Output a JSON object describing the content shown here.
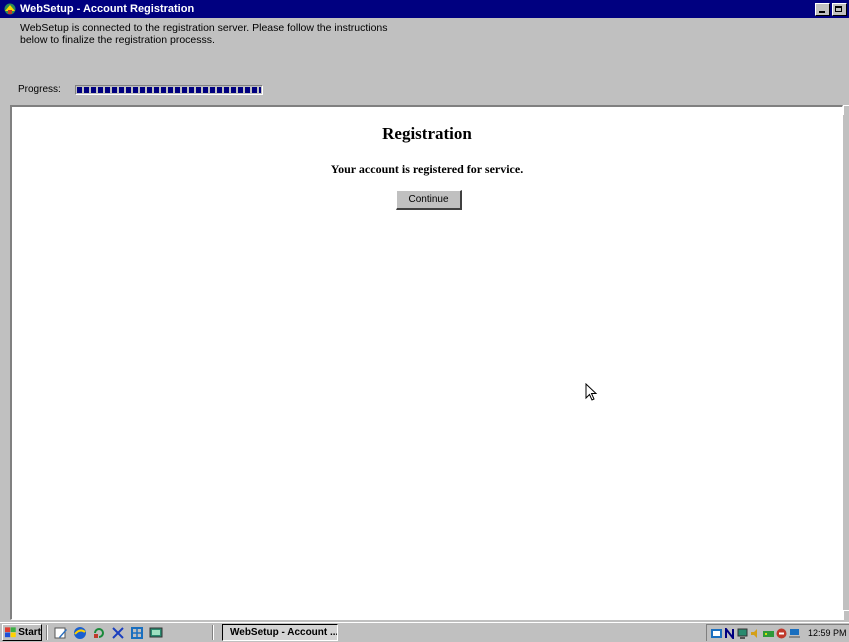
{
  "window": {
    "title": "WebSetup - Account Registration",
    "instructions_line1": "WebSetup is connected to the registration server. Please follow the instructions",
    "instructions_line2": "below to finalize the registration processs."
  },
  "progress": {
    "label": "Progress:",
    "value_fraction": 1.0
  },
  "content": {
    "heading": "Registration",
    "message": "Your account is registered for service.",
    "continue_label": "Continue"
  },
  "taskbar": {
    "start_label": "Start",
    "quick_launch_icons": [
      "edit-icon",
      "browser-icon",
      "refresh-icon",
      "pen-icon",
      "network-icon",
      "monitor-icon"
    ],
    "task_label": "WebSetup - Account ...",
    "tray_icons": [
      "network-tray-icon",
      "n-tray-icon",
      "display-tray-icon",
      "speaker-tray-icon",
      "modem-tray-icon",
      "antivirus-tray-icon",
      "computer-tray-icon"
    ],
    "clock": "12:59 PM"
  },
  "colors": {
    "title_bar": "#000080",
    "window_bg": "#c0c0c0",
    "progress_fill": "#000080",
    "content_bg": "#ffffff"
  }
}
